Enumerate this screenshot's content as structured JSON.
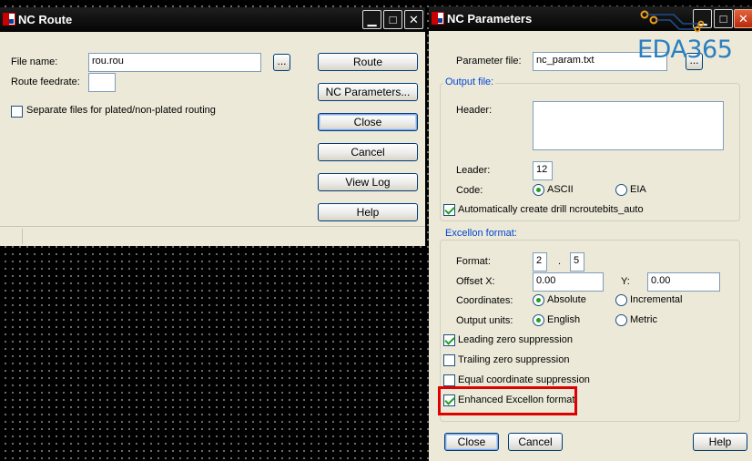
{
  "nc_route": {
    "title": "NC Route",
    "controls": {
      "minimize": "▁",
      "maximize": "□",
      "close": "✕"
    },
    "file_name_label": "File name:",
    "file_name_value": "rou.rou",
    "browse_label": "...",
    "feedrate_label": "Route feedrate:",
    "feedrate_value": "",
    "separate_files_label": "Separate files for plated/non-plated routing",
    "separate_files_checked": false,
    "buttons": {
      "route": "Route",
      "nc_parameters": "NC Parameters...",
      "close": "Close",
      "cancel": "Cancel",
      "view_log": "View Log",
      "help": "Help"
    }
  },
  "nc_parameters": {
    "title": "NC Parameters",
    "controls": {
      "minimize": "▁",
      "maximize": "□",
      "close": "✕"
    },
    "parameter_file_label": "Parameter file:",
    "parameter_file_value": "nc_param.txt",
    "browse_label": "...",
    "output_file": {
      "group_title": "Output file:",
      "header_label": "Header:",
      "header_value": "",
      "leader_label": "Leader:",
      "leader_value": "12",
      "code_label": "Code:",
      "code_options": [
        "ASCII",
        "EIA"
      ],
      "code_selected": "ASCII",
      "auto_create_label": "Automatically create drill ncroutebits_auto",
      "auto_create_checked": true
    },
    "excellon": {
      "group_title": "Excellon format:",
      "format_label": "Format:",
      "format_integer": "2",
      "format_separator": ".",
      "format_decimal": "5",
      "offset_x_label": "Offset X:",
      "offset_x_value": "0.00",
      "offset_y_label": "Y:",
      "offset_y_value": "0.00",
      "coordinates_label": "Coordinates:",
      "coordinates_options": [
        "Absolute",
        "Incremental"
      ],
      "coordinates_selected": "Absolute",
      "units_label": "Output units:",
      "units_options": [
        "English",
        "Metric"
      ],
      "units_selected": "English",
      "leading_zero_label": "Leading zero suppression",
      "leading_zero_checked": true,
      "trailing_zero_label": "Trailing zero suppression",
      "trailing_zero_checked": false,
      "equal_coord_label": "Equal coordinate suppression",
      "equal_coord_checked": false,
      "enhanced_label": "Enhanced Excellon format",
      "enhanced_checked": true
    },
    "buttons": {
      "close": "Close",
      "cancel": "Cancel",
      "help": "Help"
    }
  },
  "watermark": {
    "text": "EDA365",
    "color": "#2b7fc0",
    "accent": "#f0a020"
  },
  "colors": {
    "highlight": "#e00000",
    "dialog_bg": "#ece9d8",
    "titlebar": "#0a0a0a",
    "group_title": "#0046d5"
  }
}
